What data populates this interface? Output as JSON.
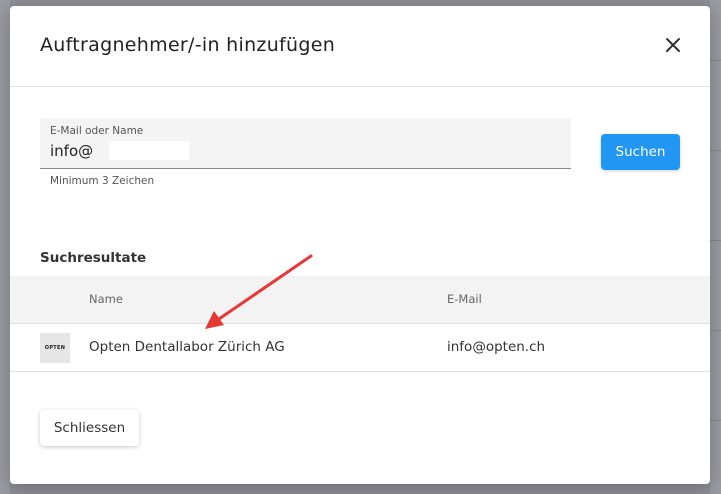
{
  "dialog": {
    "title": "Auftragnehmer/-in hinzufügen"
  },
  "search": {
    "label": "E-Mail oder Name",
    "value": "info@",
    "hint": "Minimum 3 Zeichen",
    "button_label": "Suchen"
  },
  "results": {
    "title": "Suchresultate",
    "columns": [
      "Name",
      "E-Mail"
    ],
    "rows": [
      {
        "logo_text": "OPTEN",
        "name": "Opten Dentallabor Zürich AG",
        "email": "info@opten.ch"
      }
    ]
  },
  "footer": {
    "close_label": "Schliessen"
  },
  "colors": {
    "accent": "#2196f3",
    "annotation_arrow": "#e53935"
  }
}
